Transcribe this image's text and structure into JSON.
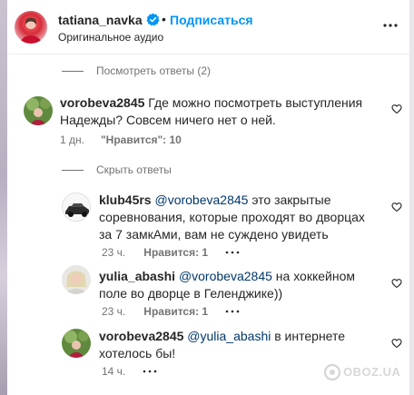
{
  "header": {
    "username": "tatiana_navka",
    "dot": "•",
    "subscribe_label": "Подписаться",
    "subtitle": "Оригинальное аудио"
  },
  "view_replies": {
    "label": "Посмотреть ответы (2)"
  },
  "comment_main": {
    "username": "vorobeva2845",
    "text": "Где можно посмотреть выступления Надежды? Совсем ничего нет о ней.",
    "time": "1 дн.",
    "likes": "\"Нравится\": 10"
  },
  "hide_replies": {
    "label": "Скрыть ответы"
  },
  "replies": [
    {
      "username": "klub45rs",
      "mention": "@vorobeva2845",
      "text": "это закрытые соревнования, которые проходят во дворцах за 7 замкАми, вам не суждено увидеть",
      "time": "23 ч.",
      "likes": "Нравится: 1"
    },
    {
      "username": "yulia_abashi",
      "mention": "@vorobeva2845",
      "text": "на хоккейном поле во дворце в Геленджике))",
      "time": "23 ч.",
      "likes": "Нравится: 1"
    },
    {
      "username": "vorobeva2845",
      "mention": "@yulia_abashi",
      "text": "в интернете хотелось бы!",
      "time": "14 ч."
    }
  ],
  "watermark": {
    "text": "OBOZ.UA"
  },
  "icons": {
    "verified": "verified-badge-icon",
    "more": "more-options-icon",
    "heart": "heart-icon",
    "reply_options": "reply-options-icon"
  },
  "colors": {
    "link_blue": "#0095f6",
    "mention": "#00376b",
    "muted": "#737373",
    "text": "#262626"
  }
}
